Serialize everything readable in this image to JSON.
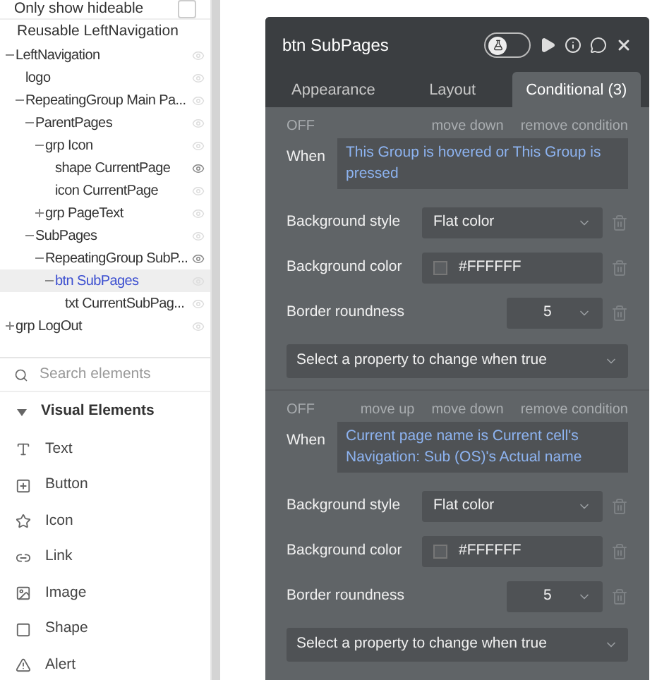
{
  "tree_panel": {
    "hideable_filter": {
      "label": "Only show hideable",
      "checked": false
    },
    "reusable_title": "Reusable LeftNavigation",
    "tree": [
      {
        "label": "LeftNavigation",
        "expanded": true,
        "visible": false,
        "selected": false,
        "children": [
          {
            "label": "logo",
            "visible": false,
            "selected": false
          },
          {
            "label": "RepeatingGroup Main Pa...",
            "expanded": true,
            "visible": false,
            "selected": false,
            "children": [
              {
                "label": "ParentPages",
                "expanded": true,
                "visible": false,
                "selected": false,
                "children": [
                  {
                    "label": "grp Icon",
                    "expanded": true,
                    "visible": false,
                    "selected": false,
                    "children": [
                      {
                        "label": "shape CurrentPage",
                        "visible": true,
                        "selected": false
                      },
                      {
                        "label": "icon CurrentPage",
                        "visible": false,
                        "selected": false
                      }
                    ]
                  },
                  {
                    "label": "grp PageText",
                    "expanded": false,
                    "visible": false,
                    "selected": false
                  }
                ]
              },
              {
                "label": "SubPages",
                "expanded": true,
                "visible": false,
                "selected": false,
                "children": [
                  {
                    "label": "RepeatingGroup SubP...",
                    "expanded": true,
                    "visible": true,
                    "selected": false,
                    "children": [
                      {
                        "label": "btn SubPages",
                        "expanded": true,
                        "visible": false,
                        "selected": true,
                        "children": [
                          {
                            "label": "txt CurrentSubPag...",
                            "visible": false,
                            "selected": false
                          }
                        ]
                      }
                    ]
                  }
                ]
              }
            ]
          }
        ]
      },
      {
        "label": "grp LogOut",
        "expanded": false,
        "visible": false,
        "selected": false
      }
    ],
    "search": {
      "placeholder": "Search elements"
    },
    "section": {
      "title": "Visual Elements",
      "expanded": true
    },
    "elements": [
      {
        "kind": "text",
        "label": "Text"
      },
      {
        "kind": "button",
        "label": "Button"
      },
      {
        "kind": "icon",
        "label": "Icon"
      },
      {
        "kind": "link",
        "label": "Link"
      },
      {
        "kind": "image",
        "label": "Image"
      },
      {
        "kind": "shape",
        "label": "Shape"
      },
      {
        "kind": "alert",
        "label": "Alert"
      }
    ]
  },
  "editor": {
    "title": "btn SubPages",
    "preview_mode": {
      "on": false
    },
    "tabs": [
      {
        "label": "Appearance",
        "selected": false
      },
      {
        "label": "Layout",
        "selected": false
      },
      {
        "label": "Conditional (3)",
        "selected": true
      }
    ],
    "conditions": [
      {
        "actions": [
          "OFF",
          "move down",
          "remove condition"
        ],
        "when_label": "When",
        "expression": "This Group is hovered or This Group is pressed",
        "properties": [
          {
            "kind": "select",
            "label": "Background style",
            "value": "Flat color"
          },
          {
            "kind": "color",
            "label": "Background color",
            "value": "#FFFFFF"
          },
          {
            "kind": "number",
            "label": "Border roundness",
            "value": "5"
          }
        ],
        "add_property": "Select a property to change when true"
      },
      {
        "actions": [
          "OFF",
          "move up",
          "move down",
          "remove condition"
        ],
        "when_label": "When",
        "expression": "Current page name is Current cell's Navigation: Sub (OS)'s Actual name",
        "properties": [
          {
            "kind": "select",
            "label": "Background style",
            "value": "Flat color"
          },
          {
            "kind": "color",
            "label": "Background color",
            "value": "#FFFFFF"
          },
          {
            "kind": "number",
            "label": "Border roundness",
            "value": "5"
          }
        ],
        "add_property": "Select a property to change when true"
      }
    ]
  }
}
